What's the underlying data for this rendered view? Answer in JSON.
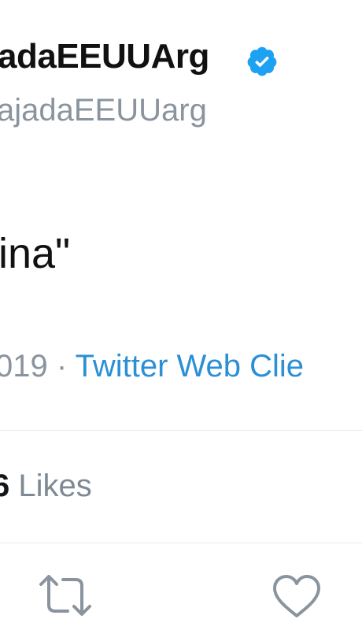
{
  "tweet": {
    "display_name": "adaEEUUArg",
    "handle": "ajadaEEUUarg",
    "text": "ina\"",
    "date": "019",
    "separator": "·",
    "source": "Twitter Web Clie",
    "likes_count": "6",
    "likes_label": "Likes"
  },
  "icons": {
    "verified": "verified-badge-icon",
    "retweet": "retweet-icon",
    "like": "heart-icon"
  },
  "colors": {
    "verified_blue": "#1da1f2",
    "link_blue": "#2b8fd6",
    "muted_gray": "#8a949e",
    "divider": "#e6ecf0"
  }
}
